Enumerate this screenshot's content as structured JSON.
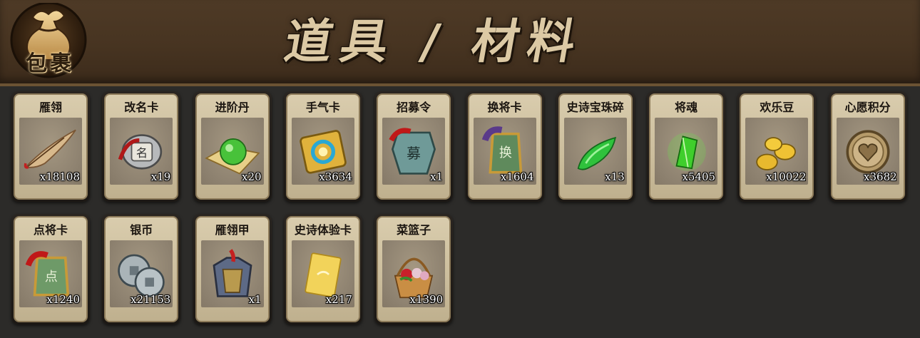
{
  "header": {
    "emblem_label": "包裹",
    "title": "道具 / 材料"
  },
  "items": [
    {
      "name": "雁翎",
      "count": "x18108",
      "icon": "feather-icon"
    },
    {
      "name": "改名卡",
      "count": "x19",
      "icon": "rename-card-icon"
    },
    {
      "name": "进阶丹",
      "count": "x20",
      "icon": "green-pill-icon"
    },
    {
      "name": "手气卡",
      "count": "x3634",
      "icon": "luck-card-icon"
    },
    {
      "name": "招募令",
      "count": "x1",
      "icon": "recruit-token-icon"
    },
    {
      "name": "换将卡",
      "count": "x1604",
      "icon": "swap-general-card-icon"
    },
    {
      "name": "史诗宝珠碎",
      "count": "x13",
      "icon": "jade-shard-icon"
    },
    {
      "name": "将魂",
      "count": "x5405",
      "icon": "general-soul-crystal-icon"
    },
    {
      "name": "欢乐豆",
      "count": "x10022",
      "icon": "gold-beans-icon"
    },
    {
      "name": "心愿积分",
      "count": "x3682",
      "icon": "heart-coin-icon"
    },
    {
      "name": "点将卡",
      "count": "x1240",
      "icon": "pick-general-card-icon"
    },
    {
      "name": "银币",
      "count": "x21153",
      "icon": "silver-coins-icon"
    },
    {
      "name": "雁翎甲",
      "count": "x1",
      "icon": "armor-icon"
    },
    {
      "name": "史诗体验卡",
      "count": "x217",
      "icon": "gold-card-icon"
    },
    {
      "name": "菜篮子",
      "count": "x1390",
      "icon": "basket-icon"
    }
  ]
}
